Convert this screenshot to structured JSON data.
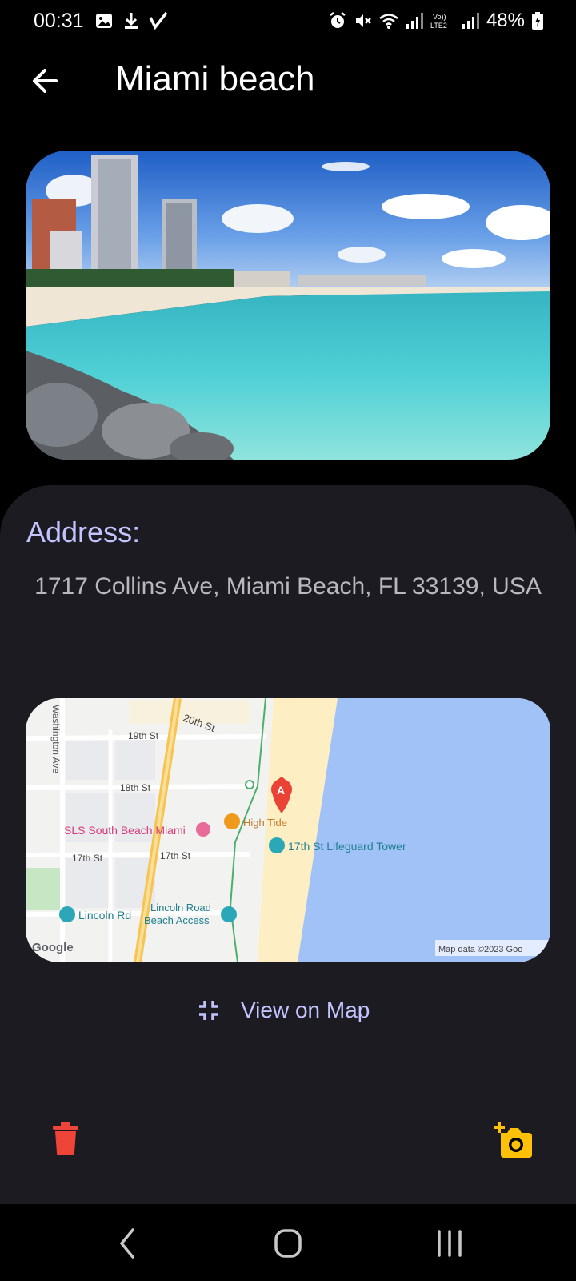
{
  "status_bar": {
    "time": "00:31",
    "battery": "48%",
    "left_icons": [
      "gallery-icon",
      "download-icon",
      "check-icon"
    ],
    "right_icons": [
      "alarm-icon",
      "mute-icon",
      "wifi-icon",
      "signal-icon",
      "volte-icon",
      "signal-icon",
      "battery-icon"
    ]
  },
  "header": {
    "title": "Miami beach"
  },
  "details": {
    "address_label": "Address:",
    "address_text": "1717 Collins Ave, Miami Beach, FL 33139, USA",
    "view_on_map": "View on Map"
  },
  "map": {
    "streets": {
      "washington": "Washington Ave",
      "st20": "20th St",
      "st19": "19th St",
      "st18": "18th St",
      "st17a": "17th St",
      "st17b": "17th St",
      "lincoln": "Lincoln Rd",
      "lincoln_access_1": "Lincoln Road",
      "lincoln_access_2": "Beach Access"
    },
    "pois": {
      "sls": "SLS South Beach Miami",
      "high_tide": "High Tide",
      "lifeguard": "17th St Lifeguard Tower"
    },
    "marker_label": "A",
    "google": "Google",
    "attribution": "Map data ©2023 Goo"
  },
  "colors": {
    "accent": "#c2c4ff",
    "delete": "#ef4538",
    "add_photo": "#ffc107",
    "sheet": "#1c1b21",
    "water": "#a1c2f7",
    "sand": "#fdefc3"
  }
}
